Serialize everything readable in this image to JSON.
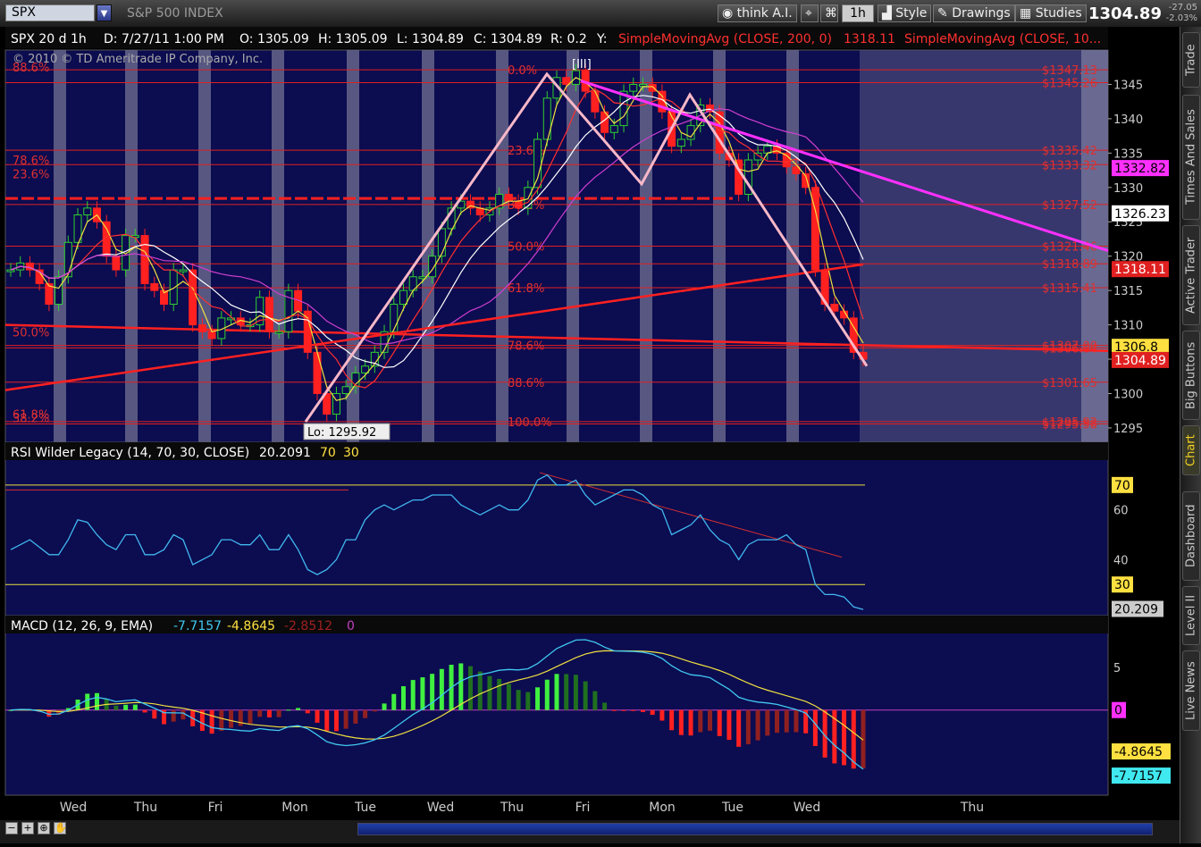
{
  "toolbar": {
    "symbol": "SPX",
    "symbol_name": "S&P 500 INDEX",
    "think_ai": "think A.I.",
    "timeframe": "1h",
    "style": "Style",
    "drawings": "Drawings",
    "studies": "Studies",
    "last_price": "1304.89",
    "change": "-27.05",
    "change_pct": "-2.03%"
  },
  "sidebar": {
    "tabs": [
      "Trade",
      "Times And Sales",
      "Active Trader",
      "Big Buttons",
      "Chart",
      "Dashboard",
      "Level II",
      "Live News"
    ],
    "active": "Chart"
  },
  "price_header": {
    "study": "SPX 20 d 1h",
    "date": "D: 7/27/11 1:00 PM",
    "open": "O: 1305.09",
    "high": "H: 1305.09",
    "low": "L: 1304.89",
    "close": "C: 1304.89",
    "range": "R: 0.2",
    "y": "Y:",
    "sma200": "SimpleMovingAvg (CLOSE, 200, 0)",
    "sma200_val": "1318.11",
    "sma_other": "SimpleMovingAvg (CLOSE, 10..."
  },
  "copyright": "© 2010 © TD Ameritrade IP Company, Inc.",
  "x_axis_days": [
    "Wed",
    "Thu",
    "Fri",
    "Mon",
    "Tue",
    "Wed",
    "Thu",
    "Fri",
    "Mon",
    "Tue",
    "Wed",
    "Thu"
  ],
  "chart_data": {
    "type": "candlestick",
    "symbol": "SPX",
    "interval": "1h",
    "ylim": [
      1292,
      1350
    ],
    "y_ticks": [
      1295,
      1300,
      1305,
      1310,
      1315,
      1320,
      1325,
      1330,
      1335,
      1340,
      1345
    ],
    "closes_hourly": [
      1318,
      1319,
      1318,
      1316,
      1313,
      1317,
      1322,
      1326,
      1327,
      1325,
      1320,
      1318,
      1323,
      1323,
      1316,
      1315,
      1313,
      1318,
      1318,
      1310,
      1309,
      1308,
      1311,
      1311,
      1310,
      1310,
      1314,
      1309,
      1309,
      1315,
      1312,
      1306,
      1300,
      1297,
      1300,
      1301,
      1303,
      1304,
      1306,
      1309,
      1313,
      1315,
      1317,
      1317,
      1320,
      1324,
      1327,
      1328,
      1327,
      1326,
      1327,
      1329,
      1328,
      1327,
      1330,
      1337,
      1343,
      1346,
      1345,
      1347,
      1344,
      1341,
      1338,
      1339,
      1344,
      1345,
      1345,
      1344,
      1341,
      1336,
      1337,
      1339,
      1342,
      1341,
      1335,
      1334,
      1329,
      1334,
      1335,
      1336,
      1335,
      1333,
      1332,
      1330,
      1318,
      1313,
      1312,
      1311,
      1306,
      1305
    ],
    "price_labels": {
      "sma200": "1318.11",
      "upper": "1332.82",
      "mid": "1326.23",
      "cursor": "1306.8",
      "last": "1304.89"
    },
    "lo_label": "Lo: 1295.92",
    "fib_left": [
      "88.6%",
      "78.6%",
      "23.6%",
      "50.0%",
      "38.2%",
      "61.8%"
    ],
    "fib_right": [
      {
        "pct": "0.0%",
        "price": "$1347.13",
        "y": 1347.13
      },
      {
        "pct": "",
        "price": "$1345.26",
        "y": 1345.26
      },
      {
        "pct": "23.6%",
        "price": "$1335.42",
        "y": 1335.42
      },
      {
        "pct": "",
        "price": "$1333.32",
        "y": 1333.32
      },
      {
        "pct": "38.2%",
        "price": "$1327.52",
        "y": 1327.52
      },
      {
        "pct": "50.0%",
        "price": "$1321.46",
        "y": 1321.46
      },
      {
        "pct": "",
        "price": "$1318.89",
        "y": 1318.89
      },
      {
        "pct": "61.8%",
        "price": "$1315.41",
        "y": 1315.41
      },
      {
        "pct": "78.6%",
        "price": "$1307.00",
        "y": 1307.0
      },
      {
        "pct": "",
        "price": "$1306.64",
        "y": 1306.64
      },
      {
        "pct": "88.6%",
        "price": "$1301.65",
        "y": 1301.65
      },
      {
        "pct": "100.0%",
        "price": "$1295.92",
        "y": 1295.92
      },
      {
        "pct": "",
        "price": "$1295.58",
        "y": 1295.58
      }
    ],
    "pattern_marker": "[III]"
  },
  "rsi": {
    "title": "RSI Wilder Legacy (14, 70, 30, CLOSE)",
    "value": "20.2091",
    "ob": "70",
    "os": "30",
    "ylim": [
      15,
      80
    ],
    "ticks": [
      40,
      60
    ],
    "last_label": "20.209",
    "values": [
      44,
      46,
      48,
      45,
      42,
      42,
      48,
      56,
      55,
      50,
      46,
      44,
      50,
      50,
      42,
      42,
      44,
      50,
      48,
      38,
      40,
      42,
      48,
      48,
      46,
      46,
      50,
      44,
      44,
      50,
      44,
      36,
      34,
      36,
      40,
      48,
      48,
      56,
      60,
      62,
      60,
      62,
      64,
      64,
      66,
      66,
      66,
      62,
      60,
      58,
      60,
      62,
      60,
      60,
      64,
      72,
      74,
      70,
      70,
      72,
      66,
      62,
      64,
      66,
      68,
      68,
      66,
      62,
      60,
      50,
      52,
      54,
      58,
      52,
      48,
      46,
      40,
      46,
      48,
      48,
      48,
      50,
      46,
      44,
      30,
      26,
      26,
      25,
      21,
      20
    ]
  },
  "macd": {
    "title": "MACD (12, 26, 9, EMA)",
    "value": "-7.7157",
    "avg": "-4.8645",
    "diff": "-2.8512",
    "zero": "0",
    "ylim": [
      -10,
      9
    ],
    "ticks": [
      5,
      0
    ],
    "labels": {
      "avg": "-4.8645",
      "value": "-7.7157",
      "zero": "0"
    }
  }
}
